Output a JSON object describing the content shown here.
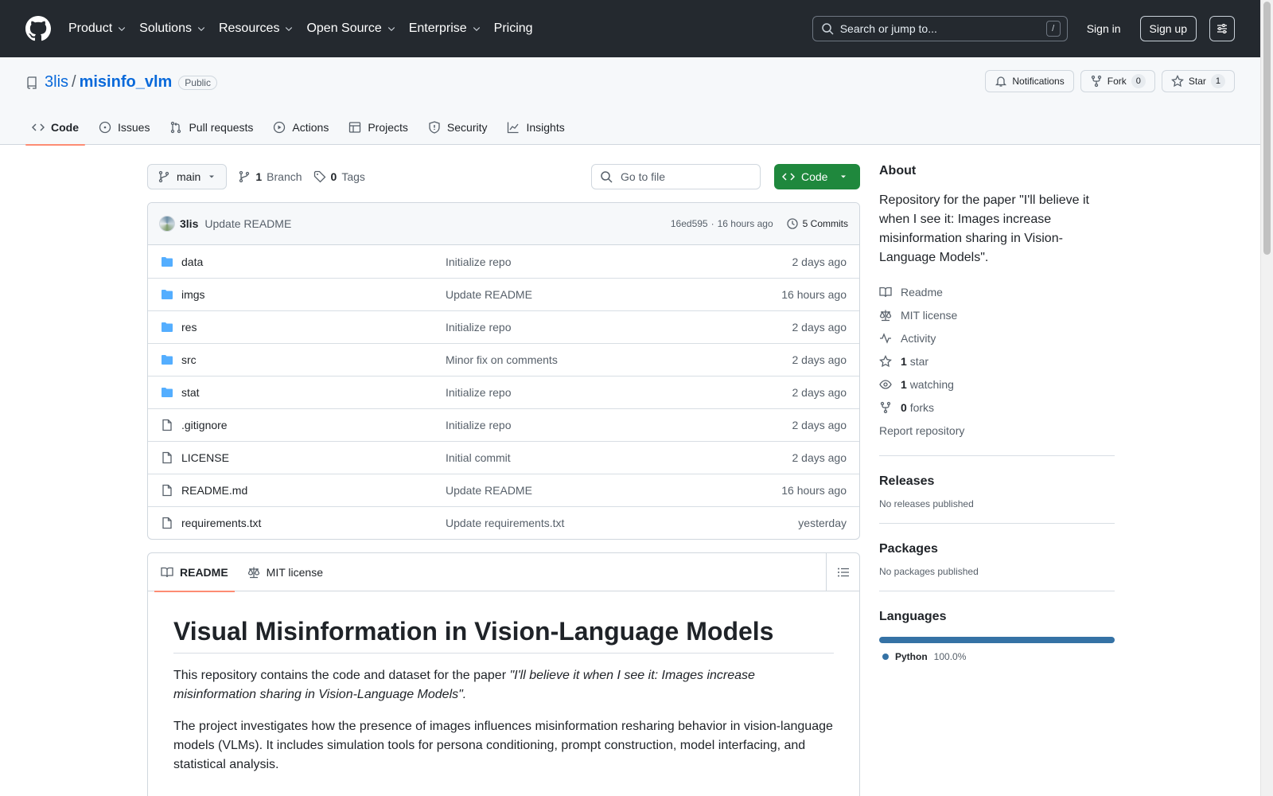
{
  "header": {
    "nav": [
      "Product",
      "Solutions",
      "Resources",
      "Open Source",
      "Enterprise",
      "Pricing"
    ],
    "search_placeholder": "Search or jump to...",
    "slash_key": "/",
    "sign_in": "Sign in",
    "sign_up": "Sign up"
  },
  "repo": {
    "owner": "3lis",
    "separator": "/",
    "name": "misinfo_vlm",
    "visibility": "Public",
    "notifications_label": "Notifications",
    "fork_label": "Fork",
    "fork_count": "0",
    "star_label": "Star",
    "star_count": "1",
    "tabs": [
      "Code",
      "Issues",
      "Pull requests",
      "Actions",
      "Projects",
      "Security",
      "Insights"
    ]
  },
  "toolbar": {
    "branch": "main",
    "branch_count": "1",
    "branch_label": "Branch",
    "tag_count": "0",
    "tag_label": "Tags",
    "goto_placeholder": "Go to file",
    "code_button": "Code"
  },
  "latest_commit": {
    "author": "3lis",
    "message": "Update README",
    "sha": "16ed595",
    "dot": "·",
    "time": "16 hours ago",
    "commits_count": "5 Commits"
  },
  "files": [
    {
      "name": "data",
      "type": "dir",
      "commit": "Initialize repo",
      "date": "2 days ago"
    },
    {
      "name": "imgs",
      "type": "dir",
      "commit": "Update README",
      "date": "16 hours ago"
    },
    {
      "name": "res",
      "type": "dir",
      "commit": "Initialize repo",
      "date": "2 days ago"
    },
    {
      "name": "src",
      "type": "dir",
      "commit": "Minor fix on comments",
      "date": "2 days ago"
    },
    {
      "name": "stat",
      "type": "dir",
      "commit": "Initialize repo",
      "date": "2 days ago"
    },
    {
      "name": ".gitignore",
      "type": "file",
      "commit": "Initialize repo",
      "date": "2 days ago"
    },
    {
      "name": "LICENSE",
      "type": "file",
      "commit": "Initial commit",
      "date": "2 days ago"
    },
    {
      "name": "README.md",
      "type": "file",
      "commit": "Update README",
      "date": "16 hours ago"
    },
    {
      "name": "requirements.txt",
      "type": "file",
      "commit": "Update requirements.txt",
      "date": "yesterday"
    }
  ],
  "readme": {
    "tab_readme": "README",
    "tab_license": "MIT license",
    "title": "Visual Misinformation in Vision-Language Models",
    "p1_prefix": "This repository contains the code and dataset for the paper ",
    "p1_italic": "\"I'll believe it when I see it: Images increase misinformation sharing in Vision-Language Models\".",
    "p2": "The project investigates how the presence of images influences misinformation resharing behavior in vision-language models (VLMs). It includes simulation tools for persona conditioning, prompt construction, model interfacing, and statistical analysis."
  },
  "sidebar": {
    "about_title": "About",
    "description": "Repository for the paper \"I'll believe it when I see it: Images increase misinformation sharing in Vision-Language Models\".",
    "readme": "Readme",
    "license": "MIT license",
    "activity": "Activity",
    "stars_count": "1",
    "stars_label": "star",
    "watching_count": "1",
    "watching_label": "watching",
    "forks_count": "0",
    "forks_label": "forks",
    "report": "Report repository",
    "releases_title": "Releases",
    "releases_empty": "No releases published",
    "packages_title": "Packages",
    "packages_empty": "No packages published",
    "languages_title": "Languages",
    "language_name": "Python",
    "language_pct": "100.0%",
    "language_color": "#3572a5"
  },
  "colors": {
    "header_bg": "#24292f",
    "link": "#0969da",
    "code_button": "#1f883d",
    "active_tab_underline": "#fd8c73",
    "folder": "#54aeff"
  }
}
